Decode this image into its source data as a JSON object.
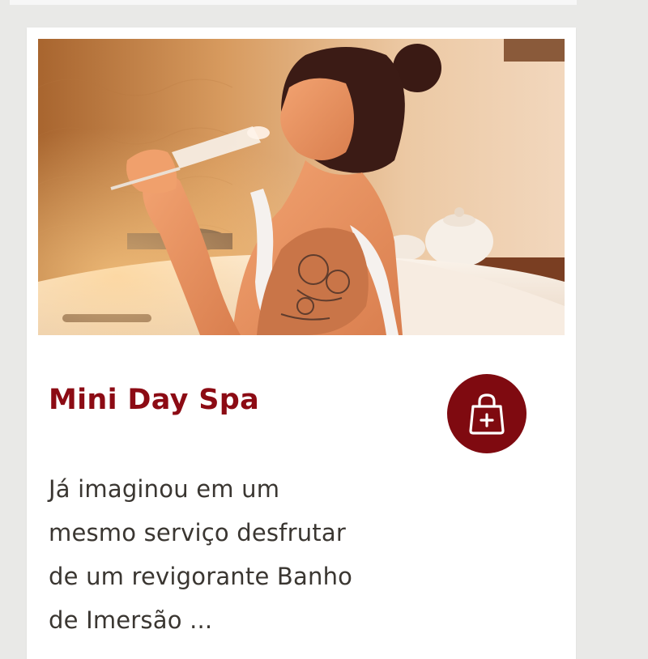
{
  "card": {
    "image_alt": "Mulher tatuada bebendo espumante em uma banheira de imersão",
    "title": "Mini Day Spa",
    "description_lines": [
      "Já imaginou em um",
      "mesmo serviço desfrutar",
      "de um revigorante Banho",
      "de Imersão ..."
    ],
    "cart_button_icon": "shopping-bag-plus-icon"
  },
  "colors": {
    "page_background": "#e9e9e7",
    "card_background": "#ffffff",
    "title": "#8c0b14",
    "cart_button": "#7f0a10",
    "description_text": "#3a3631"
  }
}
